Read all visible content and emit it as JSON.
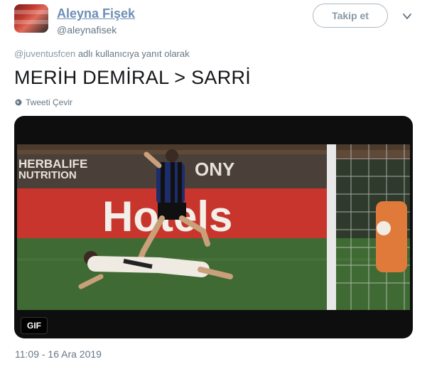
{
  "user": {
    "display_name": "Aleyna Fişek",
    "handle": "@aleynafisek"
  },
  "actions": {
    "follow_label": "Takip et"
  },
  "reply": {
    "mention": "@juventusfcen",
    "suffix": " adlı kullanıcıya yanıt olarak"
  },
  "tweet": {
    "text": "MERİH DEMİRAL > SARRİ",
    "translate_label": "Tweeti Çevir",
    "timestamp": "11:09 - 16 Ara 2019"
  },
  "media": {
    "badge": "GIF",
    "board_texts": [
      "HERBALIFE",
      "NUTRITION",
      "ONY",
      "Hotels"
    ]
  },
  "colors": {
    "name": "#6e8fb5",
    "muted": "#657786",
    "pitch": "#3f6a34",
    "board_red": "#c8352d"
  }
}
